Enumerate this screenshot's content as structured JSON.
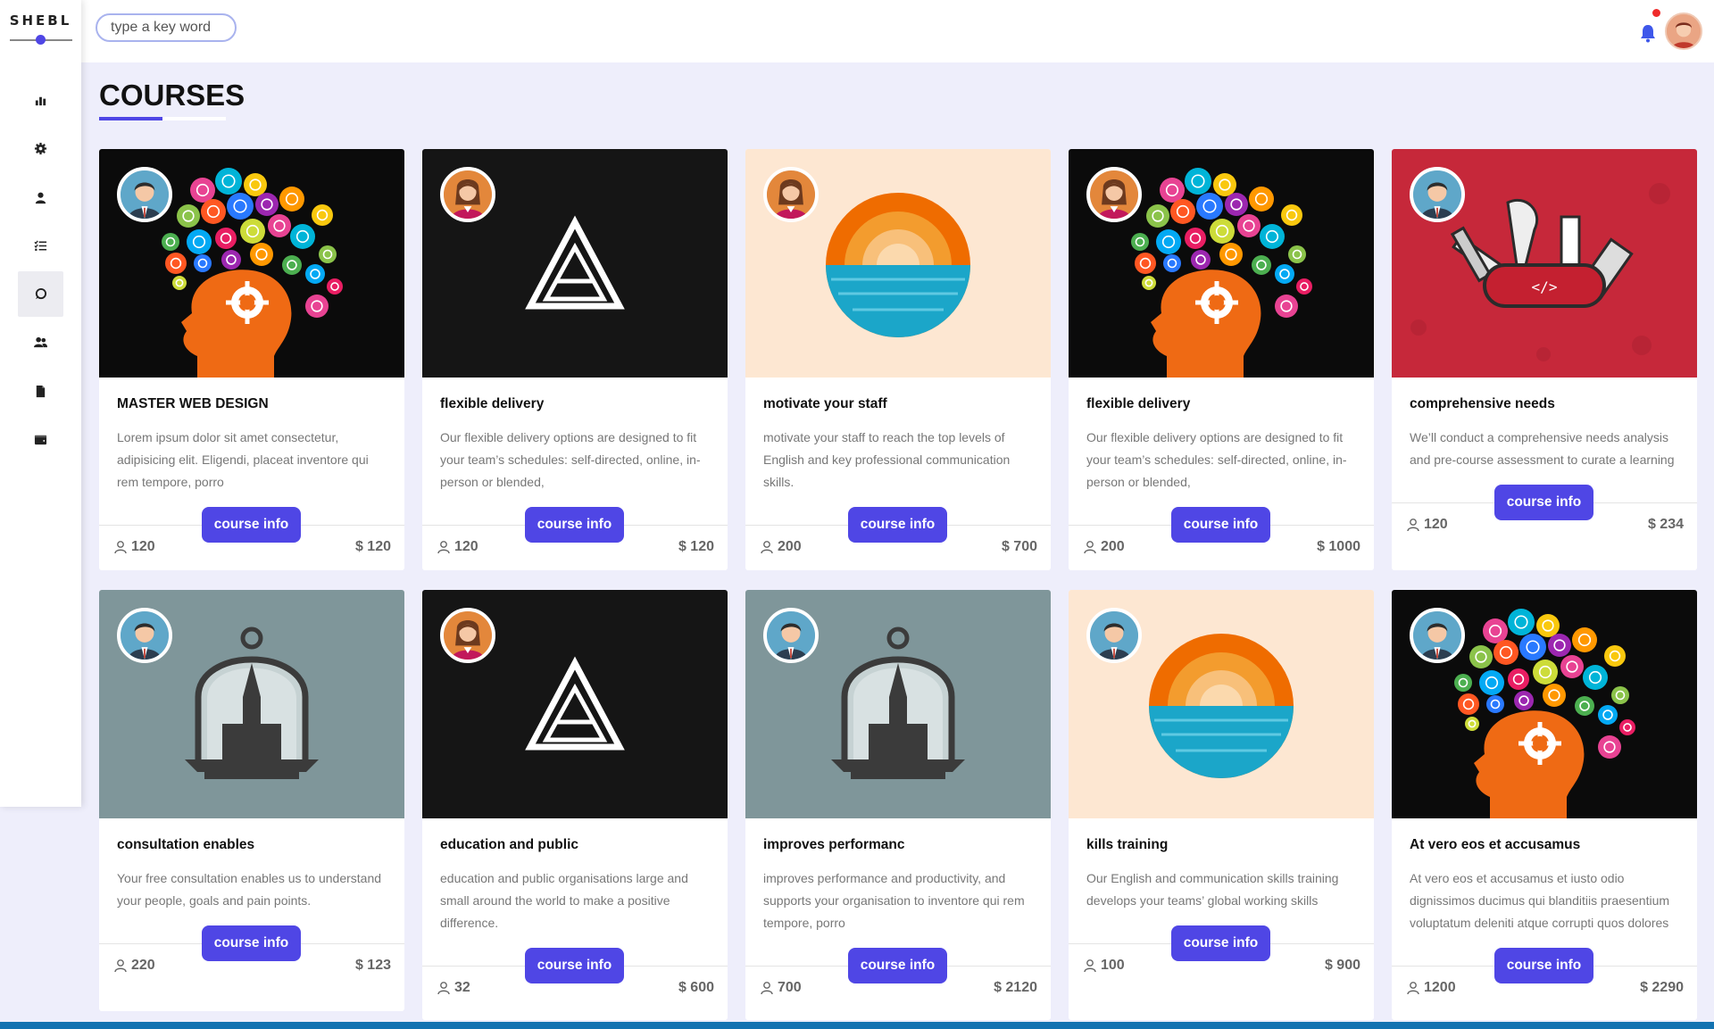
{
  "brand": "SHEBL",
  "search": {
    "placeholder": "type a key word"
  },
  "page_title": "COURSES",
  "colors": {
    "accent": "#4f46e5",
    "notification": "#ef2b2b",
    "background": "#eeeefb"
  },
  "sidebar": {
    "items": [
      {
        "icon": "bar-chart-icon"
      },
      {
        "icon": "gear-icon"
      },
      {
        "icon": "user-icon"
      },
      {
        "icon": "checklist-icon"
      },
      {
        "icon": "chat-icon",
        "active": true
      },
      {
        "icon": "users-icon"
      },
      {
        "icon": "file-icon"
      },
      {
        "icon": "wallet-icon"
      }
    ]
  },
  "header": {
    "bell_icon": "bell-icon",
    "avatar": "avatar"
  },
  "courses": [
    {
      "title": "MASTER WEB DESIGN",
      "description": "Lorem ipsum dolor sit amet consectetur, adipisicing elit. Eligendi, placeat inventore qui rem tempore, porro",
      "button": "course info",
      "students": "120",
      "price": "$ 120",
      "image": "brain-art",
      "avatar": "man-avatar"
    },
    {
      "title": "flexible delivery",
      "description": "Our flexible delivery options are designed to fit your team’s schedules: self-directed, online, in-person or blended,",
      "button": "course info",
      "students": "120",
      "price": "$ 120",
      "image": "triangle-logo",
      "avatar": "woman-avatar"
    },
    {
      "title": "motivate your staff",
      "description": "motivate your staff to reach the top levels of English and key professional communication skills.",
      "button": "course info",
      "students": "200",
      "price": "$ 700",
      "image": "sunset-circle",
      "avatar": "woman-avatar"
    },
    {
      "title": "flexible delivery",
      "description": "Our flexible delivery options are designed to fit your team’s schedules: self-directed, online, in-person or blended,",
      "button": "course info",
      "students": "200",
      "price": "$ 1000",
      "image": "brain-art",
      "avatar": "woman-avatar"
    },
    {
      "title": "comprehensive needs",
      "description": "We’ll conduct a comprehensive needs analysis and pre-course assessment to curate a learning",
      "button": "course info",
      "students": "120",
      "price": "$ 234",
      "image": "swiss-knife",
      "avatar": "man-avatar"
    },
    {
      "title": "consultation enables",
      "description": "Your free consultation enables us to understand your people, goals and pain points.",
      "button": "course info",
      "students": "220",
      "price": "$ 123",
      "image": "bell-jar",
      "avatar": "man-avatar"
    },
    {
      "title": "education and public",
      "description": "education and public organisations large and small around the world to make a positive difference.",
      "button": "course info",
      "students": "32",
      "price": "$ 600",
      "image": "triangle-logo",
      "avatar": "woman-avatar"
    },
    {
      "title": "improves performanc",
      "description": "improves performance and productivity, and supports your organisation to inventore qui rem tempore, porro",
      "button": "course info",
      "students": "700",
      "price": "$ 2120",
      "image": "bell-jar",
      "avatar": "man-avatar"
    },
    {
      "title": "kills training",
      "description": "Our English and communication skills training develops your teams’ global working skills",
      "button": "course info",
      "students": "100",
      "price": "$ 900",
      "image": "sunset-circle",
      "avatar": "man-avatar"
    },
    {
      "title": "At vero eos et accusamus",
      "description": "At vero eos et accusamus et iusto odio dignissimos ducimus qui blanditiis praesentium voluptatum deleniti atque corrupti quos dolores",
      "button": "course info",
      "students": "1200",
      "price": "$ 2290",
      "image": "brain-art",
      "avatar": "man-avatar"
    }
  ]
}
